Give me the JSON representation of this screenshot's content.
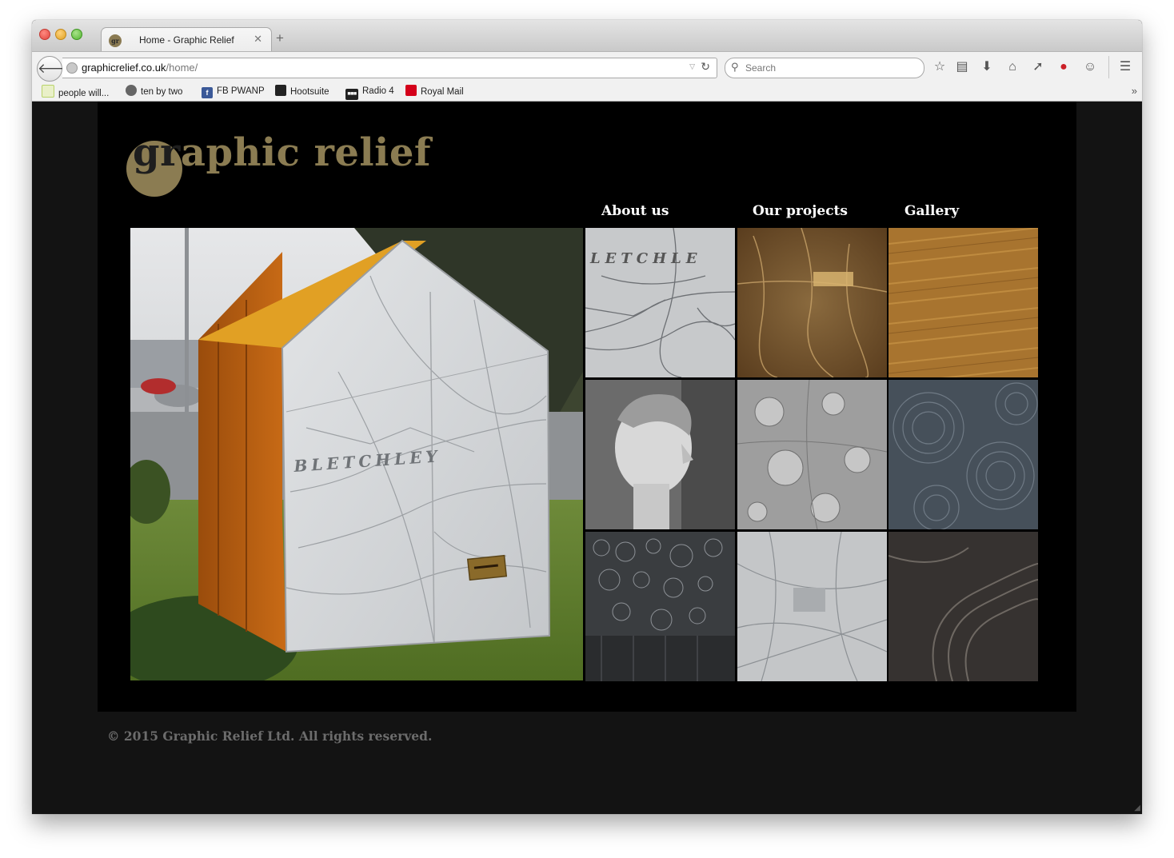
{
  "browser": {
    "tab": {
      "title": "Home - Graphic Relief",
      "favicon_text": "gr"
    },
    "url": {
      "domain": "graphicrelief.co.uk",
      "path": "/home/"
    },
    "search": {
      "placeholder": "Search"
    },
    "bookmarks": [
      {
        "label": "people will...",
        "icon": "notepad-icon",
        "color": "#b9d36a"
      },
      {
        "label": "ten by two",
        "icon": "globe-avatar-icon",
        "color": "#666666"
      },
      {
        "label": "FB PWANP",
        "icon": "facebook-icon",
        "color": "#3b5998"
      },
      {
        "label": "Hootsuite",
        "icon": "owl-icon",
        "color": "#222222"
      },
      {
        "label": "Radio 4",
        "icon": "bbc-icon",
        "color": "#222222"
      },
      {
        "label": "Royal Mail",
        "icon": "royal-mail-icon",
        "color": "#d4001a"
      }
    ]
  },
  "site": {
    "logo_text": "aphic relief",
    "logo_mark": "gr",
    "nav": [
      {
        "label": "About us"
      },
      {
        "label": "Our projects"
      },
      {
        "label": "Gallery"
      }
    ],
    "hero_map_label": "BLETCHLEY",
    "thumb_map_label": "LETCHLE",
    "footer": "© 2015 Graphic Relief Ltd. All rights reserved.",
    "colors": {
      "brand_gold": "#8b7c52",
      "page_bg": "#131313",
      "panel_bg": "#000000"
    }
  }
}
